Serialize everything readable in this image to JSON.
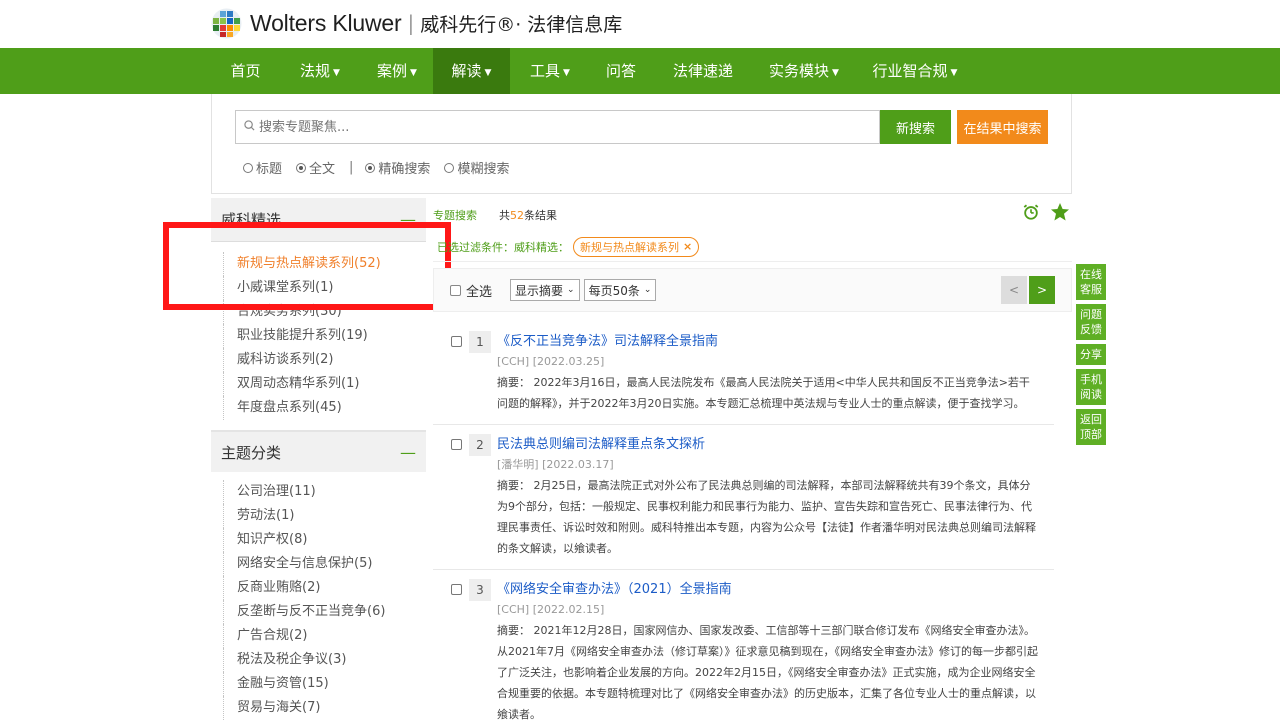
{
  "header": {
    "brand": "Wolters Kluwer",
    "brand_cn": "威科先行®· 法律信息库"
  },
  "nav": {
    "items": [
      {
        "label": "首页",
        "caret": false
      },
      {
        "label": "法规",
        "caret": true
      },
      {
        "label": "案例",
        "caret": true
      },
      {
        "label": "解读",
        "caret": true
      },
      {
        "label": "工具",
        "caret": true
      },
      {
        "label": "问答",
        "caret": false
      },
      {
        "label": "法律速递",
        "caret": false
      },
      {
        "label": "实务模块",
        "caret": true
      },
      {
        "label": "行业智合规",
        "caret": true
      }
    ],
    "active_index": 3
  },
  "search": {
    "placeholder": "搜索专题聚焦...",
    "new_search": "新搜索",
    "search_in_results": "在结果中搜索",
    "options": [
      "标题",
      "全文",
      "精确搜索",
      "模糊搜索"
    ],
    "separator": "|"
  },
  "sidebar": {
    "section1_title": "威科精选",
    "section1_items": [
      "新规与热点解读系列(52)",
      "小威课堂系列(1)",
      "合规实务系列(30)",
      "职业技能提升系列(19)",
      "威科访谈系列(2)",
      "双周动态精华系列(1)",
      "年度盘点系列(45)"
    ],
    "section2_title": "主题分类",
    "section2_items": [
      "公司治理(11)",
      "劳动法(1)",
      "知识产权(8)",
      "网络安全与信息保护(5)",
      "反商业贿赂(2)",
      "反垄断与反不正当竞争(6)",
      "广告合规(2)",
      "税法及税企争议(3)",
      "金融与资管(15)",
      "贸易与海关(7)"
    ],
    "collapse_symbol": "—"
  },
  "results": {
    "topic_label": "专题搜索",
    "count_prefix": "共",
    "count": "52",
    "count_suffix": "条结果",
    "filter_label": "已选过滤条件：威科精选：",
    "filter_tag": "新规与热点解读系列",
    "select_all": "全选",
    "display_select": "显示摘要",
    "perpage_select": "每页50条",
    "prev": "<",
    "next": ">",
    "items": [
      {
        "num": "1",
        "title": "《反不正当竞争法》司法解释全景指南",
        "meta": "[CCH] [2022.03.25]",
        "abstract": "摘要： 2022年3月16日，最高人民法院发布《最高人民法院关于适用<中华人民共和国反不正当竞争法>若干问题的解释》，并于2022年3月20日实施。本专题汇总梳理中英法规与专业人士的重点解读，便于查找学习。"
      },
      {
        "num": "2",
        "title": "民法典总则编司法解释重点条文探析",
        "meta": "[潘华明] [2022.03.17]",
        "abstract": "摘要： 2月25日，最高法院正式对外公布了民法典总则编的司法解释，本部司法解释统共有39个条文，具体分为9个部分，包括：一般规定、民事权利能力和民事行为能力、监护、宣告失踪和宣告死亡、民事法律行为、代理民事责任、诉讼时效和附则。威科特推出本专题，内容为公众号【法徒】作者潘华明对民法典总则编司法解释的条文解读，以飨读者。"
      },
      {
        "num": "3",
        "title": "《网络安全审查办法》（2021）全景指南",
        "meta": "[CCH] [2022.02.15]",
        "abstract": "摘要： 2021年12月28日，国家网信办、国家发改委、工信部等十三部门联合修订发布《网络安全审查办法》。从2021年7月《网络安全审查办法（修订草案）》征求意见稿到现在，《网络安全审查办法》修订的每一步都引起了广泛关注，也影响着企业发展的方向。2022年2月15日，《网络安全审查办法》正式实施，成为企业网络安全合规重要的依据。本专题特梳理对比了《网络安全审查办法》的历史版本，汇集了各位专业人士的重点解读，以飨读者。"
      }
    ]
  },
  "float_bar": [
    "在线客服",
    "问题反馈",
    "分享",
    "手机阅读",
    "返回顶部"
  ],
  "colors": {
    "brand_green": "#4f9e19",
    "active_nav": "#3a7a0e",
    "orange": "#f28a1b",
    "link_blue": "#1c5cc7",
    "highlight_red": "#ff1717"
  }
}
